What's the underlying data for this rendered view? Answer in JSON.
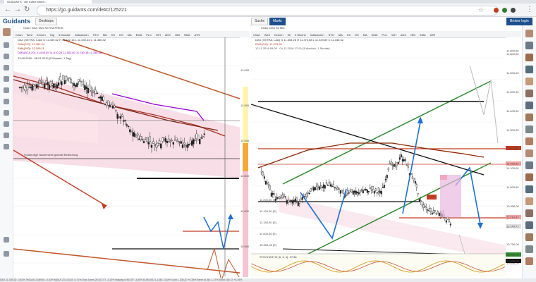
{
  "browser": {
    "tab_title": "GUIDANTS · der Kothe strebt...",
    "url": "https://go.guidants.com/de#c/125221",
    "back_icon": "arrow-left",
    "forward_icon": "arrow-right",
    "reload_icon": "reload",
    "star_icon": "star",
    "menu_icon": "kebab",
    "extension_colors": [
      "#c23b22",
      "#2e7d32",
      "#444444"
    ]
  },
  "app": {
    "logo": "Guidants",
    "buttons": {
      "desktop": "Desktops",
      "search": "Suche",
      "market": "Markt"
    },
    "broker_label": "Broker login",
    "accent_color": "#1c4f8c"
  },
  "left_chart": {
    "header": "Chart: DAX TAG XETRA PREIS",
    "toolbar": [
      "Chart",
      "Werl",
      "Kerzen",
      "Tag",
      "6 Monate",
      "Indikatoren",
      "STO",
      "MA",
      "KS",
      "DS",
      "MA",
      "EMA",
      "PLC",
      "WH",
      "ADX",
      "OBI",
      "SMA",
      "ATR"
    ],
    "legend": [
      {
        "text": "DAX (XETRA, Last)  O 11.409,62  H 11.442,16  L 11.330,44  C 11.335,32",
        "color": "#333333"
      },
      {
        "text": "SMA(200): 12.380,04",
        "color": "#c23b22"
      },
      {
        "text": "EMA(200): 12.109,11",
        "color": "#8b2500"
      },
      {
        "text": "DMA(30,5,20): 11.644,59  11.610,20  11.503,60  11.780,18  11.336,06",
        "color": "#9400d3"
      }
    ],
    "period": "23.09.2016 - 08.01.2019  (5 Monate, 1 Tag)",
    "annotation": "Vorlaeufige Nackenlinie globale Bedeutung",
    "price_labels": [
      "13.000",
      "12.500",
      "12.000",
      "11.500",
      "11.000",
      "10.500"
    ],
    "date_labels": [
      "Jan",
      "Feb",
      "Mrz",
      "Apr",
      "Mai",
      "Jun",
      "Jul",
      "Aug",
      "Sep",
      "Okt",
      "Nov",
      "Dez"
    ]
  },
  "right_chart": {
    "header": "Chart: DAX 60 Min.",
    "toolbar": [
      "Chart",
      "Werl",
      "Kerzen",
      "60",
      "5 Woche",
      "Indikatoren",
      "STO",
      "MA",
      "KS",
      "DS",
      "MA",
      "EMA",
      "PLC",
      "WH",
      "ADX",
      "OBI",
      "SMA",
      "ATR"
    ],
    "legend": [
      {
        "text": "DAX (XETRA, Last)  O 11.353,26  H 11.370,88  L 11.349,89  C 11.335,32",
        "color": "#333333"
      },
      {
        "text": "EMA(200): 11.075,00",
        "color": "#c23b22"
      },
      {
        "text": "12.11.2018 09:00 - 04.12.2018 17:00  (3 Wochen, 1 Stunde)",
        "color": "#555555"
      }
    ],
    "price_labels": [
      "11.800,00",
      "11.600,00",
      "11.500,00",
      "11.400,00",
      "11.300,00",
      "11.200,00",
      "11.100,00",
      "11.000,00",
      "10.900,00",
      "10.800,00",
      "10.700,00",
      "10.600,00"
    ],
    "highlight_labels": [
      "11.800,00",
      "11.406,46",
      "11.335,32",
      "11.214,37",
      "11.143,71",
      "10.900,00",
      "10.800,00"
    ],
    "low_labels": [
      "11.200,00 (E)",
      "11.100,00 (E)",
      "11.150,00 (E)",
      "11.000,00 (E)",
      "10.900,00 (E)",
      "10.800,00 (E)"
    ],
    "oscillator_label": "STOCHASTIK (5, 3, 3): 27,86",
    "date_labels": [
      "13",
      "14",
      "15",
      "16",
      "19",
      "20",
      "21",
      "22",
      "23",
      "26",
      "27",
      "28",
      "29",
      "30",
      "3",
      "4"
    ]
  },
  "right_rail": {
    "avatar_count": 20
  },
  "status_bar": "DAX 11.335,32 -0,83%   TecDAX 2.489,81 -0,52%   MDAX 23.103,45 -0,71%   Dow Jones 25.027,07 -3,10%   Nasdaq 6.903,57 -3,80%   EUR/USD 1,1343 -0,18%   Gold 1.236,20 +0,35%   Brent 61,88 -1,27%   Bund 160,72 +0,35%"
}
